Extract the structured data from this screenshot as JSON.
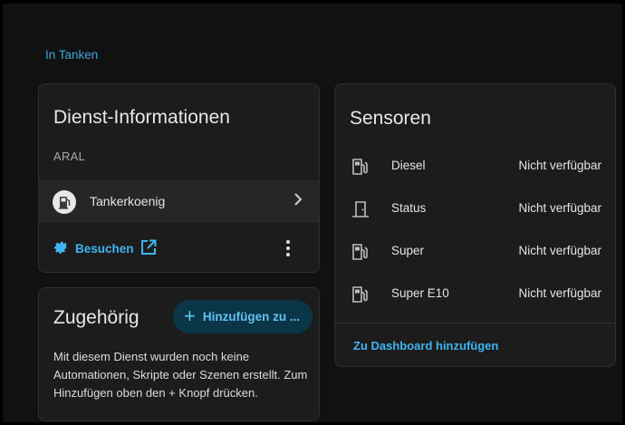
{
  "breadcrumb": "In Tanken",
  "info_card": {
    "title": "Dienst-Informationen",
    "manufacturer": "ARAL",
    "integration": {
      "label": "Tankerkoenig",
      "icon": "gas-station-logo-icon"
    },
    "visit_label": "Besuchen",
    "visit_icon": "gear-icon",
    "external_icon": "open-in-new-icon",
    "menu_icon": "dots-vertical-icon"
  },
  "related_card": {
    "title": "Zugehörig",
    "add_label": "Hinzufügen zu ...",
    "text": "Mit diesem Dienst wurden noch keine Automationen, Skripte oder Szenen erstellt. Zum Hinzufügen oben den + Knopf drücken."
  },
  "sensors_card": {
    "title": "Sensoren",
    "sensors": [
      {
        "name": "Diesel",
        "state": "Nicht verfügbar",
        "icon": "gas-station-icon"
      },
      {
        "name": "Status",
        "state": "Nicht verfügbar",
        "icon": "door-icon"
      },
      {
        "name": "Super",
        "state": "Nicht verfügbar",
        "icon": "gas-station-icon"
      },
      {
        "name": "Super E10",
        "state": "Nicht verfügbar",
        "icon": "gas-station-icon"
      }
    ],
    "dashboard_link": "Zu Dashboard hinzufügen"
  },
  "colors": {
    "accent": "#3fb4f0",
    "card_bg": "#1c1c1c",
    "page_bg": "#111111"
  }
}
